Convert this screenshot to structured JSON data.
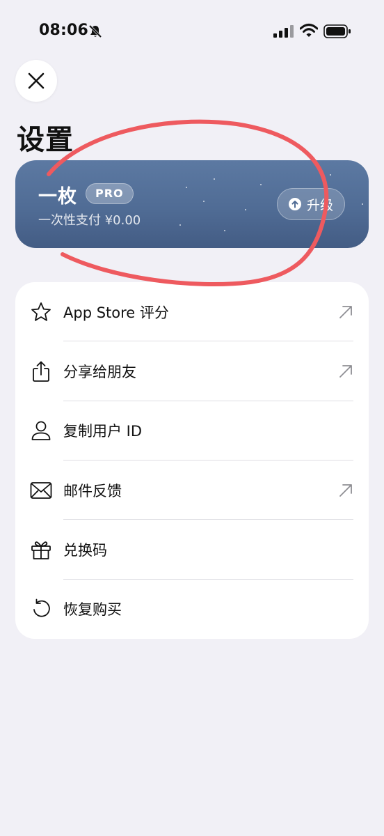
{
  "status_bar": {
    "time": "08:06"
  },
  "header": {
    "title": "设置"
  },
  "pro_card": {
    "name": "一枚",
    "badge": "PRO",
    "subtitle": "一次性支付 ¥0.00",
    "upgrade_label": "升级"
  },
  "menu": {
    "items": [
      {
        "label": "App Store 评分",
        "icon": "star-icon",
        "external": true
      },
      {
        "label": "分享给朋友",
        "icon": "share-icon",
        "external": true
      },
      {
        "label": "复制用户 ID",
        "icon": "person-icon",
        "external": false
      },
      {
        "label": "邮件反馈",
        "icon": "envelope-icon",
        "external": true
      },
      {
        "label": "兑换码",
        "icon": "gift-icon",
        "external": false
      },
      {
        "label": "恢复购买",
        "icon": "restore-icon",
        "external": false
      }
    ]
  },
  "colors": {
    "background": "#f1f0f6",
    "card_blue": "#506c95",
    "annotation_red": "#ee5a5f"
  }
}
